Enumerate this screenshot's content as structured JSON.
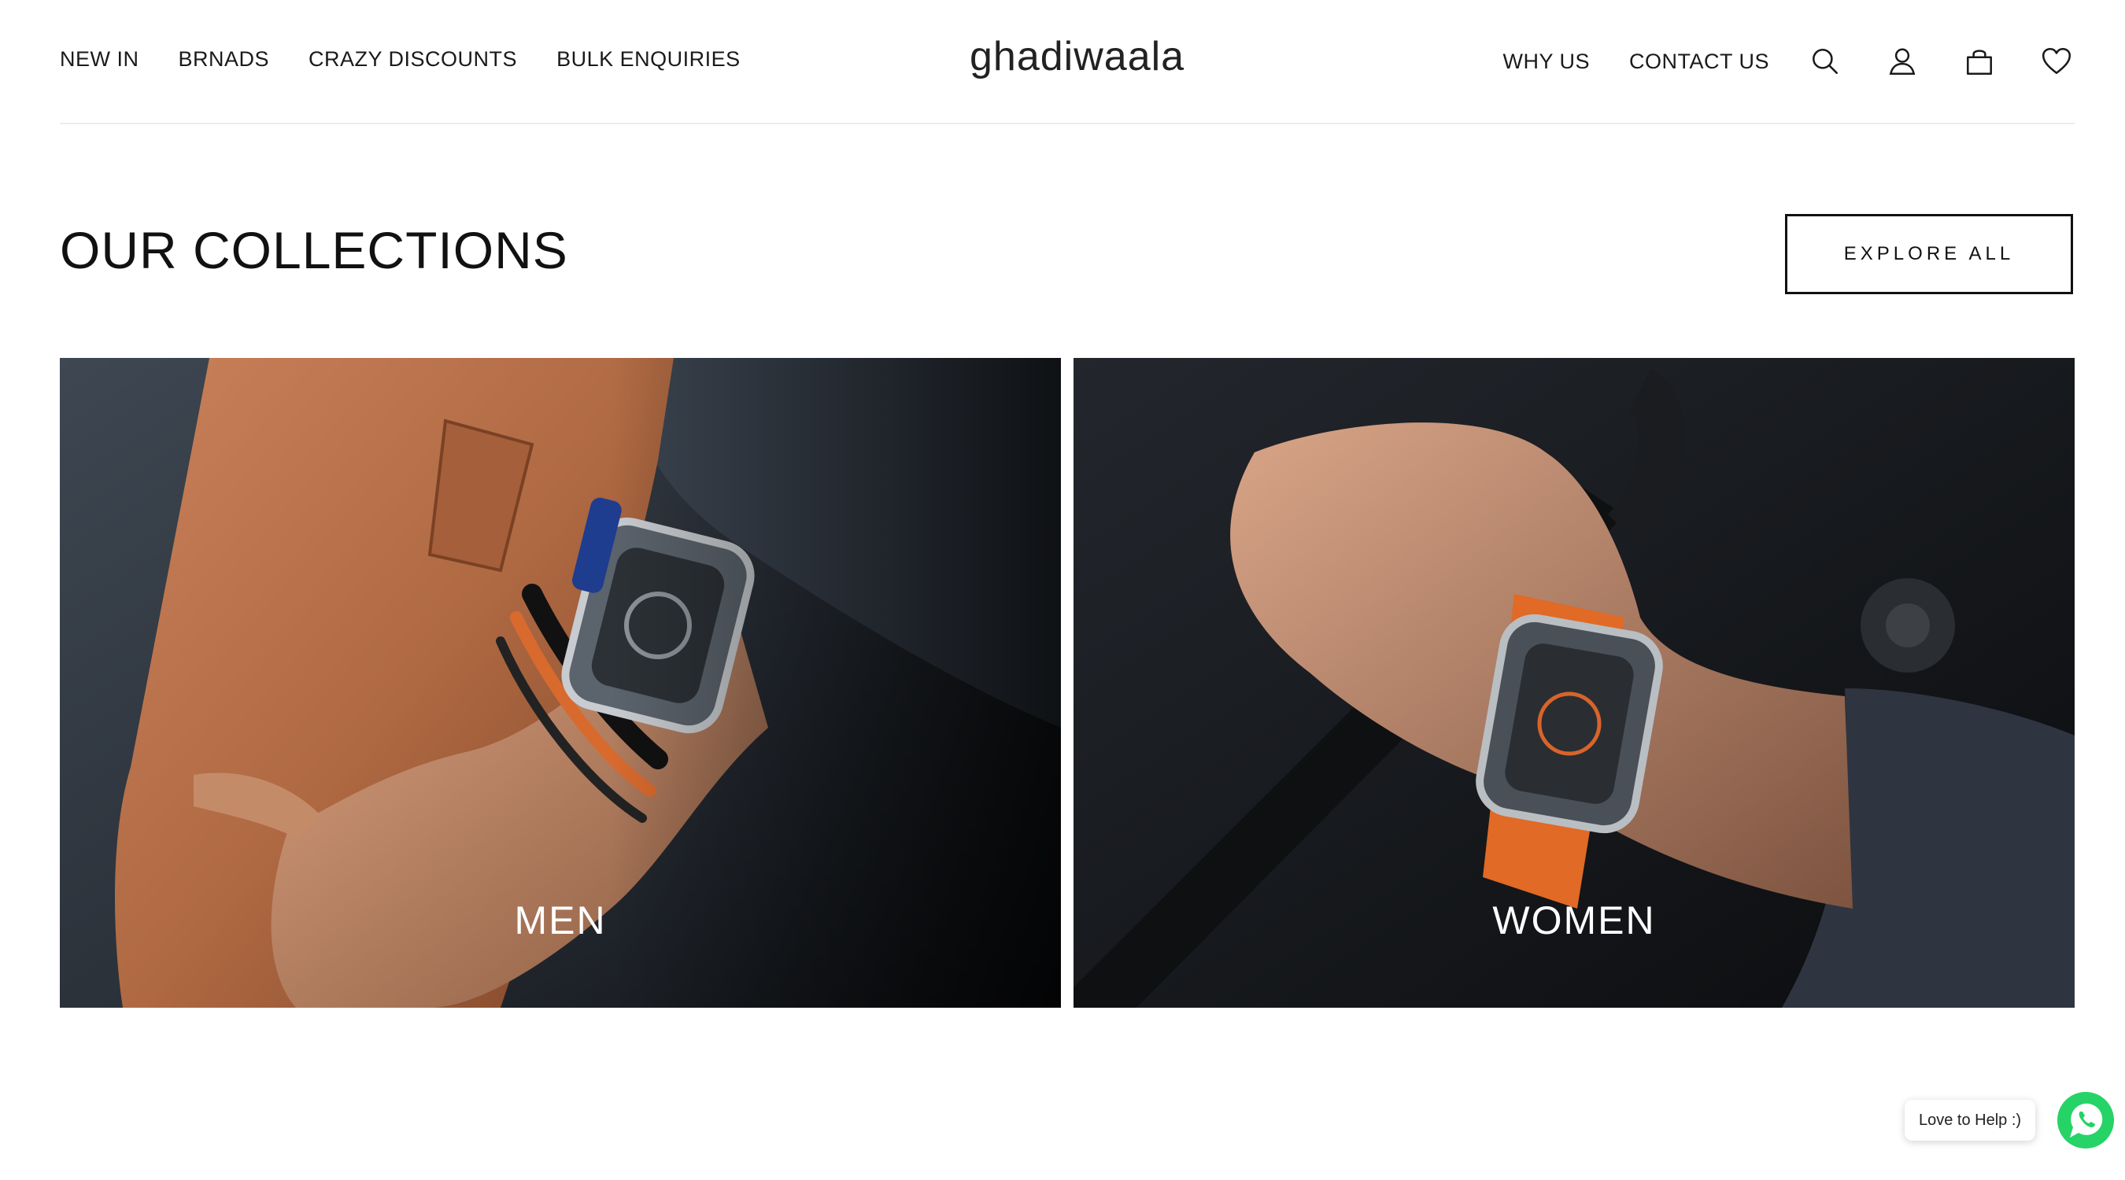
{
  "header": {
    "logo": "ghadiwaala",
    "left_nav": [
      "NEW IN",
      "BRNADS",
      "CRAZY DISCOUNTS",
      "BULK ENQUIRIES"
    ],
    "right_nav": [
      "WHY US",
      "CONTACT US"
    ],
    "icons": [
      "search-icon",
      "account-icon",
      "cart-icon",
      "wishlist-heart-icon"
    ]
  },
  "collections": {
    "title": "OUR COLLECTIONS",
    "explore_label": "EXPLORE ALL",
    "cards": [
      {
        "label": "MEN"
      },
      {
        "label": "WOMEN"
      }
    ]
  },
  "whatsapp": {
    "bubble_text": "Love to Help :)",
    "brand_color": "#25D366"
  }
}
